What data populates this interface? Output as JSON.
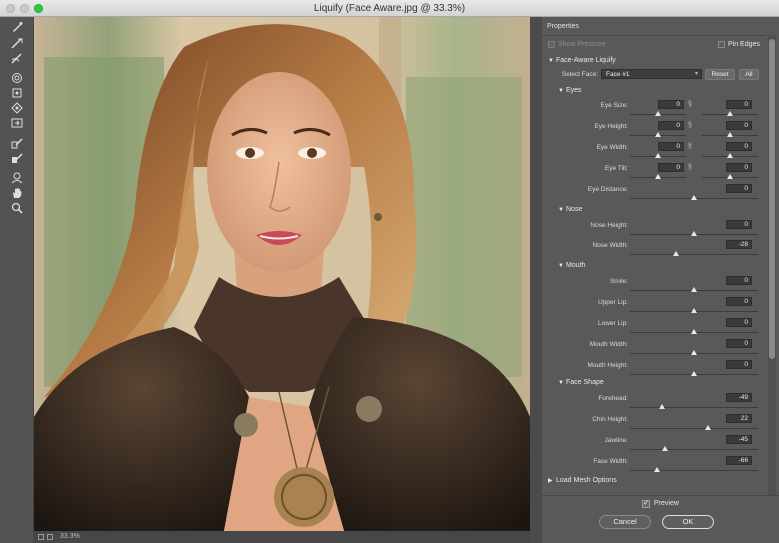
{
  "window": {
    "title": "Liquify (Face Aware.jpg @ 33.3%)"
  },
  "tools": [
    {
      "name": "forward-warp-tool-icon",
      "glyph": "✎"
    },
    {
      "name": "reconstruct-tool-icon",
      "glyph": "⟋"
    },
    {
      "name": "smooth-tool-icon",
      "glyph": "⟋"
    },
    {
      "name": "twirl-tool-icon",
      "glyph": "◎"
    },
    {
      "name": "pucker-tool-icon",
      "glyph": "⊡"
    },
    {
      "name": "bloat-tool-icon",
      "glyph": "◈"
    },
    {
      "name": "push-left-tool-icon",
      "glyph": "⧉"
    },
    {
      "name": "freeze-mask-tool-icon",
      "glyph": "✐"
    },
    {
      "name": "thaw-mask-tool-icon",
      "glyph": "✐"
    },
    {
      "name": "face-tool-icon",
      "glyph": "☺"
    },
    {
      "name": "hand-tool-icon",
      "glyph": "✋"
    },
    {
      "name": "zoom-tool-icon",
      "glyph": "⌕"
    }
  ],
  "status": {
    "zoom": "33.3%"
  },
  "panel": {
    "title": "Properties",
    "symmetrical": "Show Pressure",
    "pin_edges": "Pin Edges",
    "face_aware": {
      "title": "Face-Aware Liquify",
      "select_face_label": "Select Face:",
      "select_face_value": "Face #1",
      "reset": "Reset",
      "all": "All"
    },
    "eyes": {
      "title": "Eyes",
      "size": {
        "label": "Eye Size:",
        "left": "0",
        "right": "0"
      },
      "height": {
        "label": "Eye Height:",
        "left": "0",
        "right": "0"
      },
      "width": {
        "label": "Eye Width:",
        "left": "0",
        "right": "0"
      },
      "tilt": {
        "label": "Eye Tilt:",
        "left": "0",
        "right": "0"
      },
      "distance": {
        "label": "Eye Distance:",
        "value": "0"
      }
    },
    "nose": {
      "title": "Nose",
      "height": {
        "label": "Nose Height:",
        "value": "0"
      },
      "width": {
        "label": "Nose Width:",
        "value": "-28"
      }
    },
    "mouth": {
      "title": "Mouth",
      "smile": {
        "label": "Smile:",
        "value": "0"
      },
      "upper_lip": {
        "label": "Upper Lip:",
        "value": "0"
      },
      "lower_lip": {
        "label": "Lower Lip:",
        "value": "0"
      },
      "mouth_width": {
        "label": "Mouth Width:",
        "value": "0"
      },
      "mouth_height": {
        "label": "Mouth Height:",
        "value": "0"
      }
    },
    "face_shape": {
      "title": "Face Shape",
      "forehead": {
        "label": "Forehead:",
        "value": "-49"
      },
      "chin_height": {
        "label": "Chin Height:",
        "value": "22"
      },
      "jawline": {
        "label": "Jawline:",
        "value": "-45"
      },
      "face_width": {
        "label": "Face Width:",
        "value": "-66"
      }
    },
    "load_mesh": "Load Mesh Options",
    "preview": "Preview",
    "cancel": "Cancel",
    "ok": "OK"
  },
  "colors": {
    "panel_bg": "#595959",
    "field_bg": "#3a3a3a",
    "accent_close": "#2cc840"
  }
}
